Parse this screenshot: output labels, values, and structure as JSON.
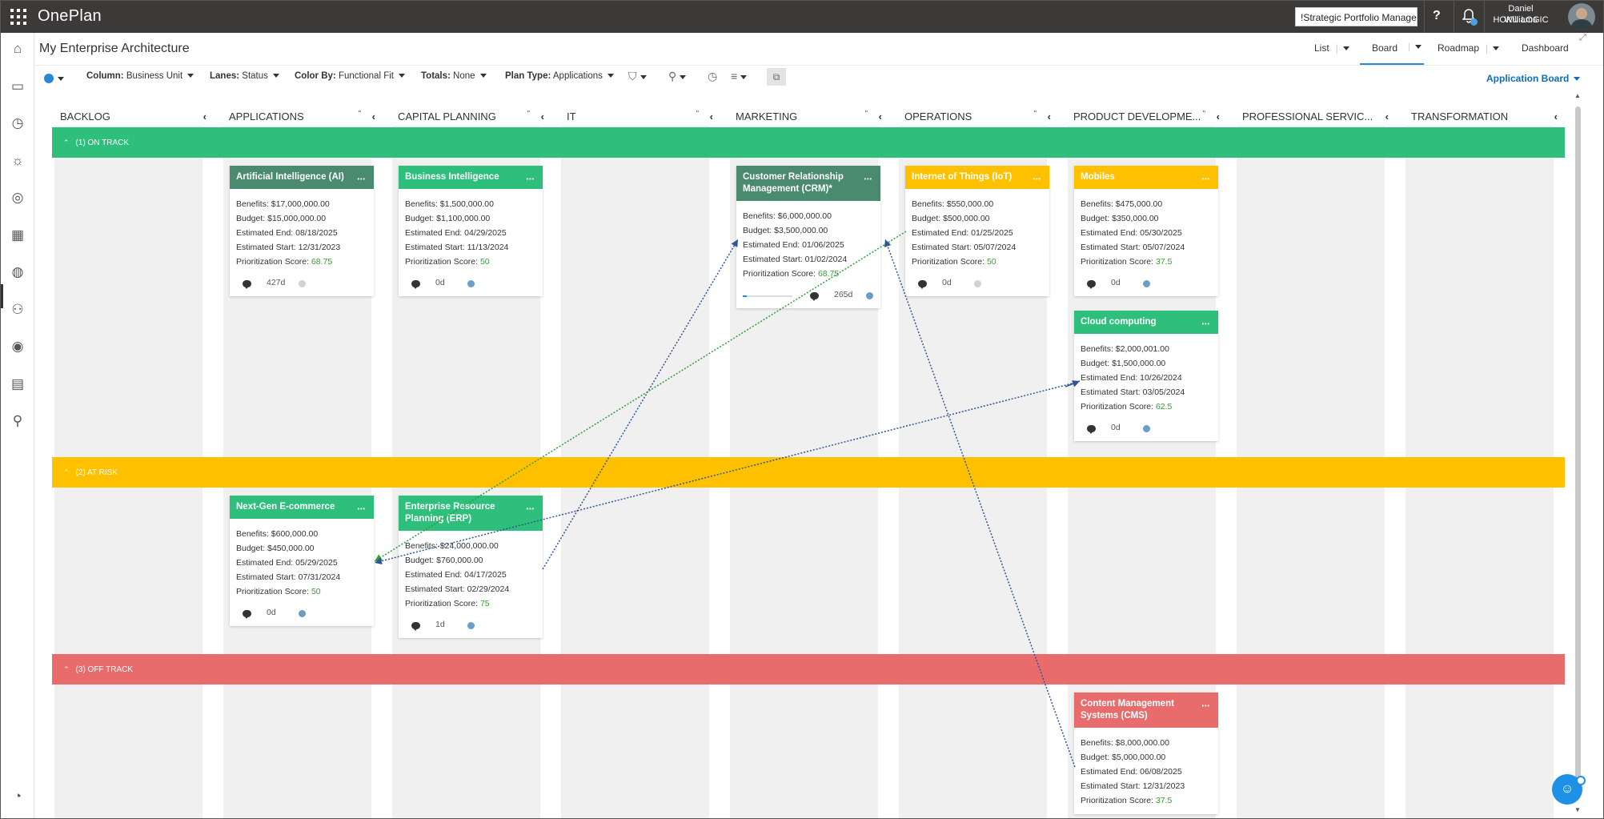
{
  "app": {
    "name": "OnePlan",
    "portfolio": "!Strategic Portfolio Manager",
    "help": "?"
  },
  "user": {
    "name": "Daniel Williams",
    "org": "HOKU LOGIC"
  },
  "page": {
    "title": "My Enterprise Architecture"
  },
  "views": {
    "list": "List",
    "board": "Board",
    "roadmap": "Roadmap",
    "dashboard": "Dashboard"
  },
  "toolbar": {
    "column_label": "Column:",
    "column_value": "Business Unit",
    "lanes_label": "Lanes:",
    "lanes_value": "Status",
    "color_label": "Color By:",
    "color_value": "Functional Fit",
    "totals_label": "Totals:",
    "totals_value": "None",
    "plantype_label": "Plan Type:",
    "plantype_value": "Applications",
    "board_select": "Application Board"
  },
  "columns": [
    "BACKLOG",
    "APPLICATIONS",
    "CAPITAL PLANNING",
    "IT",
    "MARKETING",
    "OPERATIONS",
    "PRODUCT DEVELOPME...",
    "PROFESSIONAL SERVIC...",
    "TRANSFORMATION"
  ],
  "lanes": [
    {
      "label": "(1) ON TRACK",
      "color": "#2dbf7b"
    },
    {
      "label": "(2) AT RISK",
      "color": "#ffc000"
    },
    {
      "label": "(3) OFF TRACK",
      "color": "#e86c6c"
    }
  ],
  "field_labels": {
    "benefits": "Benefits:",
    "budget": "Budget:",
    "end": "Estimated End:",
    "start": "Estimated Start:",
    "score": "Prioritization Score:"
  },
  "cards": [
    {
      "title": "Artificial Intelligence (AI)",
      "color": "#4a8a6e",
      "benefits": "$17,000,000.00",
      "budget": "$15,000,000.00",
      "end": "08/18/2025",
      "start": "12/31/2023",
      "score": "68.75",
      "days": "427d",
      "dot": "#cfd3d6"
    },
    {
      "title": "Business Intelligence",
      "color": "#2dbf7b",
      "benefits": "$1,500,000.00",
      "budget": "$1,100,000.00",
      "end": "04/29/2025",
      "start": "11/13/2024",
      "score": "50",
      "days": "0d",
      "dot": "#6b9ec4"
    },
    {
      "title": "Customer Relationship Management (CRM)*",
      "color": "#4a8a6e",
      "benefits": "$6,000,000.00",
      "budget": "$3,500,000.00",
      "end": "01/06/2025",
      "start": "01/02/2024",
      "score": "68.75",
      "days": "265d",
      "dot": "#6b9ec4",
      "progress": 0.08
    },
    {
      "title": "Internet of Things (IoT)",
      "color": "#ffc000",
      "benefits": "$550,000.00",
      "budget": "$500,000.00",
      "end": "01/25/2025",
      "start": "05/07/2024",
      "score": "50",
      "days": "0d",
      "dot": "#cfd3d6"
    },
    {
      "title": "Mobiles",
      "color": "#ffc000",
      "benefits": "$475,000.00",
      "budget": "$350,000.00",
      "end": "05/30/2025",
      "start": "05/07/2024",
      "score": "37.5",
      "days": "0d",
      "dot": "#6b9ec4"
    },
    {
      "title": "Cloud computing",
      "color": "#2dbf7b",
      "benefits": "$2,000,001.00",
      "budget": "$1,500,000.00",
      "end": "10/26/2024",
      "start": "03/05/2024",
      "score": "62.5",
      "days": "0d",
      "dot": "#6b9ec4"
    },
    {
      "title": "Next-Gen E-commerce",
      "color": "#2dbf7b",
      "benefits": "$600,000.00",
      "budget": "$450,000.00",
      "end": "05/29/2025",
      "start": "07/31/2024",
      "score": "50",
      "days": "0d",
      "dot": "#6b9ec4"
    },
    {
      "title": "Enterprise Resource Planning (ERP)",
      "color": "#2dbf7b",
      "benefits": "$24,000,000.00",
      "budget": "$760,000.00",
      "end": "04/17/2025",
      "start": "02/29/2024",
      "score": "75",
      "days": "1d",
      "dot": "#6b9ec4"
    },
    {
      "title": "Content Management Systems (CMS)",
      "color": "#e86c6c",
      "benefits": "$8,000,000.00",
      "budget": "$5,000,000.00",
      "end": "06/08/2025",
      "start": "12/31/2023",
      "score": "37.5",
      "days": "",
      "dot": ""
    }
  ]
}
